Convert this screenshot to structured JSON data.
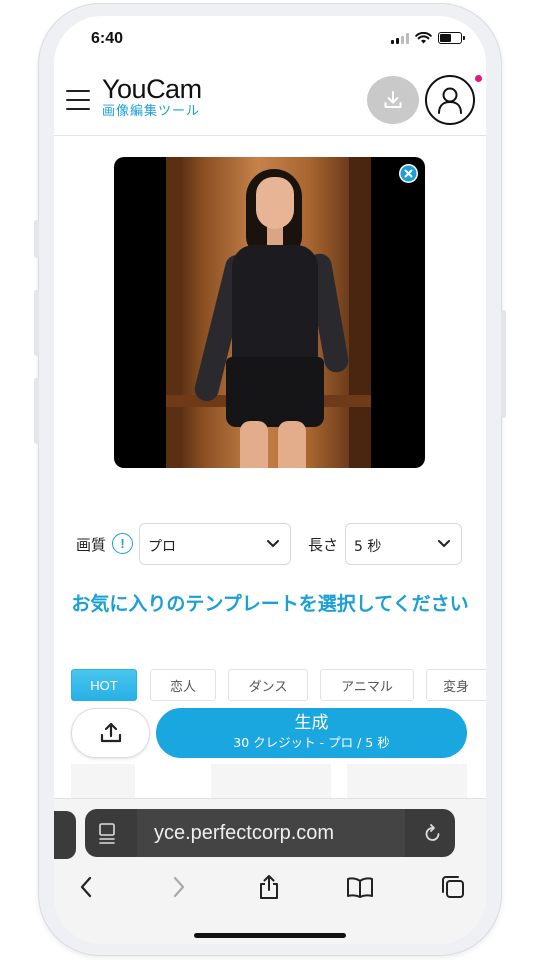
{
  "status": {
    "time": "6:40",
    "signal_bars": 2,
    "battery_level": 0.55
  },
  "header": {
    "logo_title": "YouCam",
    "logo_subtitle": "画像編集ツール",
    "menu_icon": "hamburger-menu-icon",
    "download_icon": "download-icon",
    "user_icon": "user-account-icon",
    "accent_color": "#1a9fd6",
    "notification_color": "#e6177b"
  },
  "preview": {
    "close_icon": "close-circle-icon"
  },
  "settings": {
    "quality_label": "画質",
    "info_icon_text": "!",
    "quality_value": "プロ",
    "length_label": "長さ",
    "length_value": "5 秒"
  },
  "prompt": {
    "text": "お気に入りのテンプレートを選択してください"
  },
  "tabs": [
    {
      "label": "HOT",
      "active": true
    },
    {
      "label": "恋人",
      "active": false
    },
    {
      "label": "ダンス",
      "active": false
    },
    {
      "label": "アニマル",
      "active": false
    },
    {
      "label": "変身",
      "active": false
    }
  ],
  "actions": {
    "upload_icon": "upload-icon",
    "generate_label": "生成",
    "generate_sub": "30 クレジット - プロ / 5 秒"
  },
  "browser": {
    "url": "yce.perfectcorp.com",
    "nav_icons": [
      "back-icon",
      "forward-icon",
      "share-icon",
      "bookmarks-icon",
      "tabs-icon"
    ]
  }
}
